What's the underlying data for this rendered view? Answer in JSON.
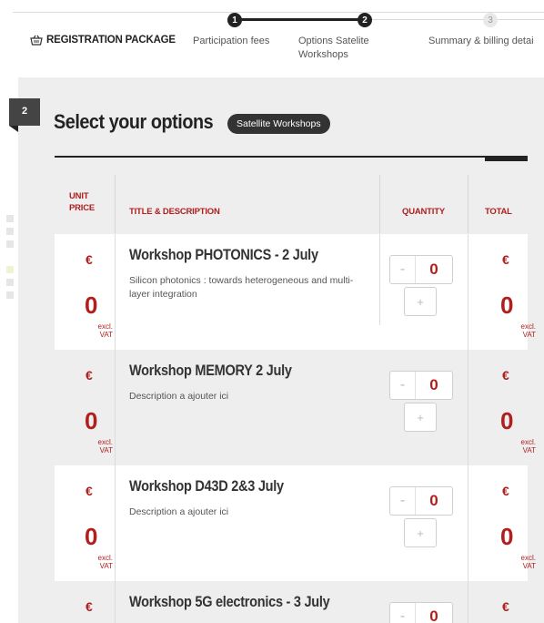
{
  "header": {
    "brand_label": "REGISTRATION PACKAGE",
    "brand_icon": "basket-icon",
    "steps": [
      {
        "number": "1",
        "label": "Participation fees",
        "state": "done"
      },
      {
        "number": "2",
        "label": "Options Satelite Workshops",
        "state": "current"
      },
      {
        "number": "3",
        "label": "Summary & billing detai",
        "state": "todo"
      }
    ]
  },
  "panel": {
    "step_number": "2",
    "title": "Select your options",
    "badge": "Satellite Workshops"
  },
  "table": {
    "headers": {
      "unit_price": "UNIT PRICE",
      "title": "TITLE & DESCRIPTION",
      "quantity": "QUANTITY",
      "total": "TOTAL"
    },
    "rows": [
      {
        "currency": "€",
        "unit_price": "0",
        "vat_note": "excl. VAT",
        "title": "Workshop PHOTONICS - 2 July",
        "description": "Silicon photonics : towards heterogeneous and multi-layer integration",
        "quantity": "0",
        "minus": "-",
        "plus": "+",
        "total_currency": "€",
        "total": "0",
        "total_vat": "excl. VAT"
      },
      {
        "currency": "€",
        "unit_price": "0",
        "vat_note": "excl. VAT",
        "title": "Workshop MEMORY 2 July",
        "description": "Description a ajouter ici",
        "quantity": "0",
        "minus": "-",
        "plus": "+",
        "total_currency": "€",
        "total": "0",
        "total_vat": "excl. VAT"
      },
      {
        "currency": "€",
        "unit_price": "0",
        "vat_note": "excl. VAT",
        "title": "Workshop D43D 2&3 July",
        "description": "Description a ajouter ici",
        "quantity": "0",
        "minus": "-",
        "plus": "+",
        "total_currency": "€",
        "total": "0",
        "total_vat": "excl. VAT"
      },
      {
        "currency": "€",
        "title": "Workshop 5G electronics - 3 July",
        "quantity": "0",
        "minus": "-",
        "total_currency": "€"
      }
    ]
  },
  "colors": {
    "accent": "#b01e1e",
    "dark": "#222222",
    "panel_bg": "#eeeeee"
  }
}
